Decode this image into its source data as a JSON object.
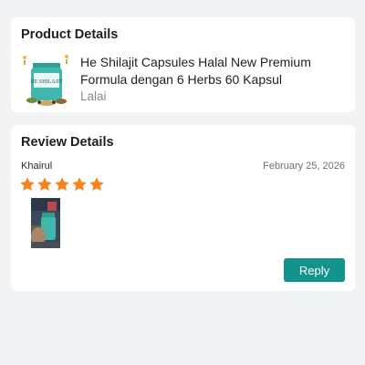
{
  "product_card": {
    "title": "Product Details",
    "product_name": "He Shilajit Capsules Halal New Premium Formula dengan 6 Herbs 60 Kapsul",
    "shop_name": "Lalai",
    "thumbnail_icon": "product-jar-thumbnail",
    "thumbnail_label": "HE SHILAJIT"
  },
  "review_card": {
    "title": "Review Details",
    "reviewer": "Khairul",
    "date": "February 25, 2026",
    "rating": 5,
    "rating_max": 5,
    "photo_icon": "review-photo",
    "reply_label": "Reply"
  },
  "colors": {
    "star": "#f5841f",
    "reply_button": "#12948c",
    "jar": "#3fb7ac",
    "background": "#f2f3f5"
  }
}
